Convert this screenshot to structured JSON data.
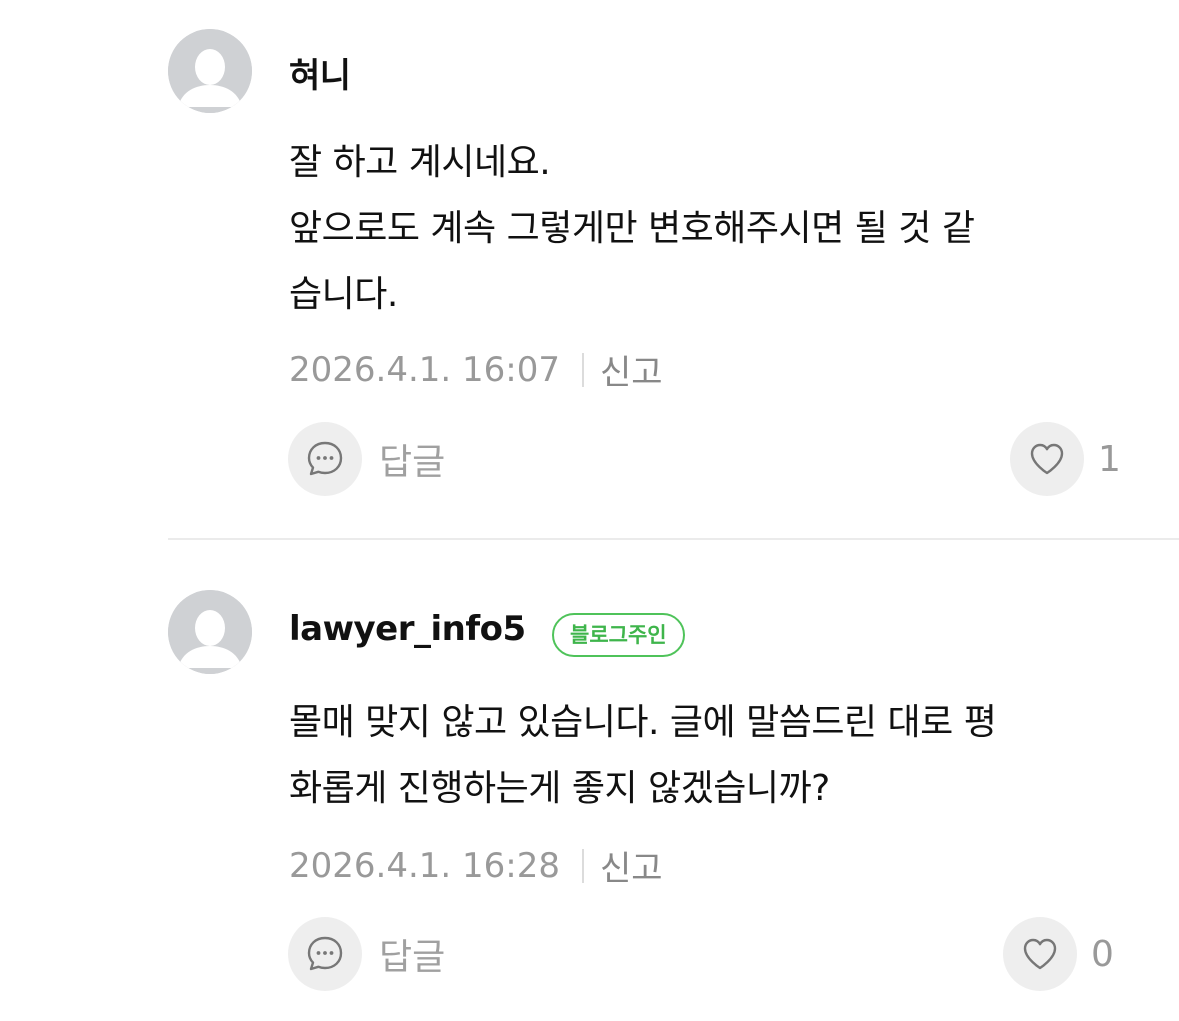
{
  "comments": [
    {
      "author": "혀니",
      "body_lines": [
        "잘 하고 계시네요.",
        "앞으로도 계속 그렇게만 변호해주시면 될 것 같",
        "습니다."
      ],
      "timestamp": "2026.4.1. 16:07",
      "report_label": "신고",
      "reply_label": "답글",
      "like_count": "1"
    },
    {
      "author": "lawyer_info5",
      "badge": "블로그주인",
      "body_lines": [
        "몰매 맞지 않고 있습니다. 글에 말씀드린 대로 평",
        "화롭게 진행하는게 좋지 않겠습니까?"
      ],
      "timestamp": "2026.4.1. 16:28",
      "report_label": "신고",
      "reply_label": "답글",
      "like_count": "0"
    }
  ],
  "icons": {
    "avatar": "default-profile-icon",
    "reply": "speech-bubble-icon",
    "like": "heart-outline-icon"
  },
  "colors": {
    "badge_green": "#4fc35a",
    "meta_gray": "#999999",
    "button_bg": "#eeeeee",
    "avatar_bg": "#cfd1d4"
  }
}
